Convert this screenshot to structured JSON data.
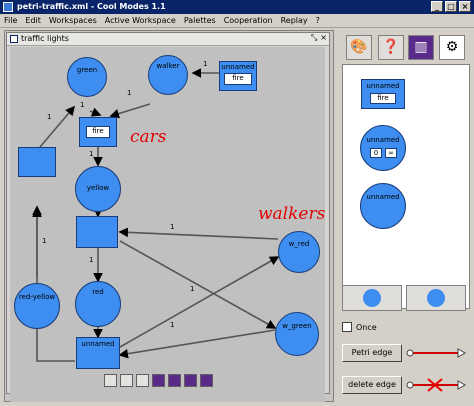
{
  "window": {
    "title": "petri-traffic.xml - Cool Modes 1.1",
    "min": "_",
    "max": "□",
    "close": "×"
  },
  "menu": [
    "File",
    "Edit",
    "Workspaces",
    "Active Workspace",
    "Palettes",
    "Cooperation",
    "Replay",
    "?"
  ],
  "frame": {
    "title": "traffic lights"
  },
  "places": {
    "green": "green",
    "walker": "walker",
    "yellow": "yellow",
    "red": "red",
    "w_red": "w_red",
    "w_green": "w_green",
    "red_yellow": "red-yellow"
  },
  "transitions": {
    "unnamed_top": "unnamed",
    "unnamed_top_value": "fire",
    "fire": "fire",
    "unnamed_bottom": "unnamed"
  },
  "arc_label": "1",
  "annotations": {
    "cars": "cars",
    "walkers": "walkers"
  },
  "palette": {
    "transition_label": "unnamed",
    "transition_value": "fire",
    "place1_label": "unnamed",
    "place1_values": [
      "0",
      "∞"
    ],
    "place2_label": "unnamed"
  },
  "controls": {
    "once": "Once",
    "petri_edge": "Petri edge",
    "delete_edge": "delete edge"
  },
  "colors": {
    "node_fill": "#3d8ef0",
    "title_bar": "#0a246a",
    "annotation": "#e00000"
  }
}
